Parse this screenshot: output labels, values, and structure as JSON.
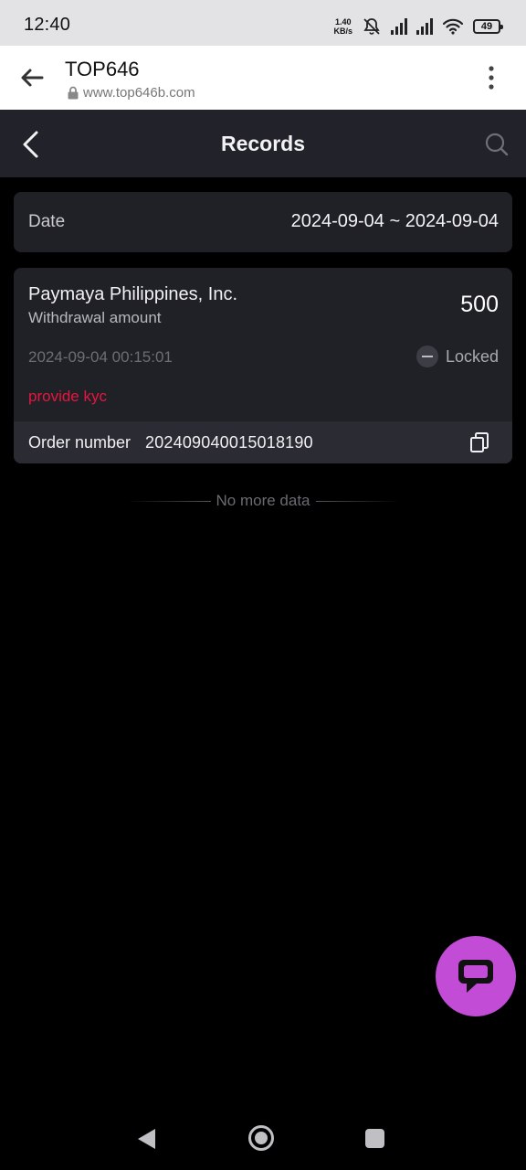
{
  "status_bar": {
    "time": "12:40",
    "speed_value": "1.40",
    "speed_unit": "KB/s",
    "battery": "49",
    "icons": [
      "mute-bell-icon",
      "signal-icon",
      "signal-icon",
      "wifi-icon",
      "battery-icon"
    ]
  },
  "browser": {
    "title": "TOP646",
    "url": "www.top646b.com",
    "icons": [
      "back-arrow-icon",
      "lock-icon",
      "more-vert-icon"
    ]
  },
  "header": {
    "title": "Records",
    "icons": [
      "chevron-left-icon",
      "search-icon"
    ]
  },
  "filter": {
    "date_label": "Date",
    "date_range": "2024-09-04 ~ 2024-09-04"
  },
  "records": [
    {
      "merchant": "Paymaya Philippines, Inc.",
      "type": "Withdrawal amount",
      "amount": "500",
      "datetime": "2024-09-04 00:15:01",
      "status": "Locked",
      "note": "provide kyc",
      "order_label": "Order number",
      "order_number": "202409040015018190"
    }
  ],
  "list_end_text": "No more data",
  "colors": {
    "background": "#000000",
    "card": "#202027",
    "header": "#22222a",
    "note": "#e6173f",
    "chat_fab": "#c24cd6"
  },
  "chat_icon": "chat-bubble-icon",
  "nav_icons": [
    "nav-back-icon",
    "nav-home-icon",
    "nav-recents-icon"
  ]
}
